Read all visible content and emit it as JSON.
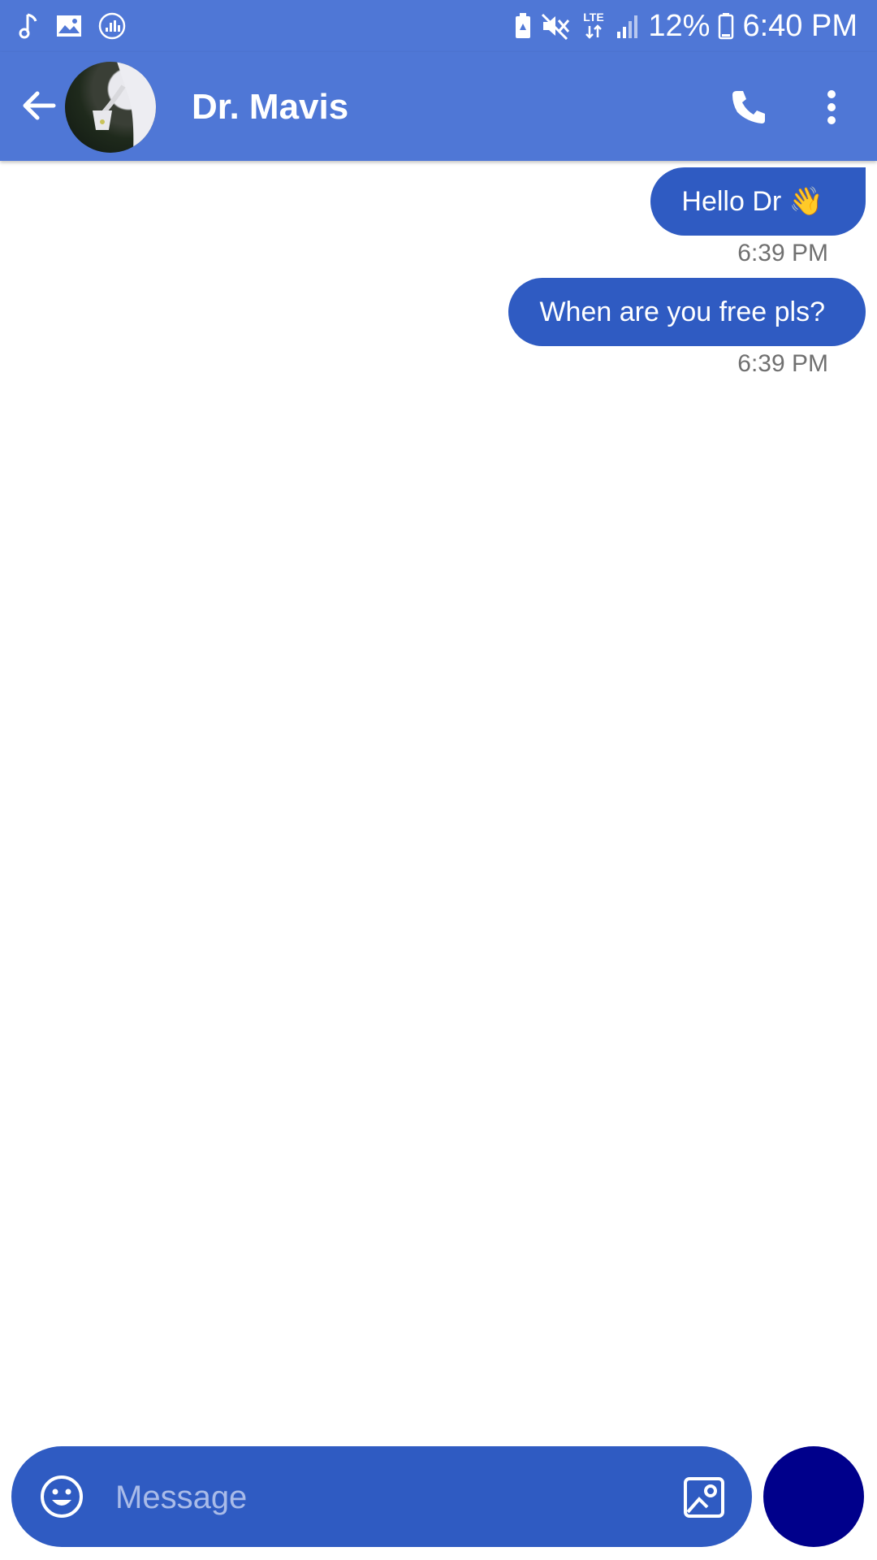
{
  "status_bar": {
    "battery_percent": "12%",
    "time": "6:40 PM",
    "network_label": "LTE",
    "left_icons": [
      "music-note-icon",
      "image-icon",
      "deezer-icon"
    ],
    "right_icons": [
      "battery-saver-icon",
      "mute-icon",
      "lte-icon",
      "signal-icon",
      "battery-icon"
    ]
  },
  "header": {
    "contact_name": "Dr. Mavis",
    "back_icon": "arrow-left-icon",
    "call_icon": "phone-icon",
    "menu_icon": "more-vert-icon",
    "background_color": "#4f77d6"
  },
  "messages": [
    {
      "text": "Hello Dr 👋",
      "time": "6:39 PM",
      "direction": "outgoing"
    },
    {
      "text": "When are you free pls?",
      "time": "6:39 PM",
      "direction": "outgoing"
    }
  ],
  "composer": {
    "placeholder": "Message",
    "value": "",
    "emoji_icon": "smiley-icon",
    "attach_icon": "image-icon",
    "background_color": "#2f5bc2",
    "send_button_color": "#00008b"
  },
  "colors": {
    "outgoing_bubble": "#2f5bc2",
    "timestamp_text": "#707070"
  }
}
